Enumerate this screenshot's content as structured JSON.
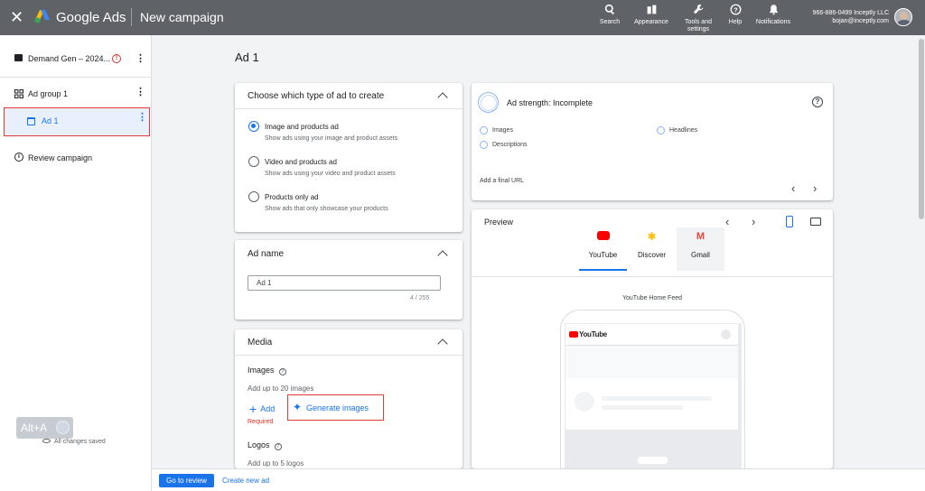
{
  "topbar": {
    "close_glyph": "✕",
    "brand": "Google Ads",
    "crumb": "New campaign",
    "actions": [
      {
        "label": "Search",
        "icon": "search-icon"
      },
      {
        "label": "Appearance",
        "icon": "appearance-icon"
      },
      {
        "label": "Tools and settings",
        "icon": "wrench-icon"
      },
      {
        "label": "Help",
        "icon": "help-icon"
      },
      {
        "label": "Notifications",
        "icon": "bell-icon"
      }
    ],
    "account_line1": "966-886-0499 Inceptly LLC",
    "account_line2": "bojan@inceptly.com"
  },
  "sidebar": {
    "campaign": "Demand Gen – 2024...",
    "ad_group": "Ad group 1",
    "ad": "Ad 1",
    "review": "Review campaign",
    "more_glyph": "⋮",
    "alert_glyph": "!",
    "info_glyph": "i"
  },
  "overlay": {
    "alt_a": "Alt+A",
    "saved": "All changes saved"
  },
  "main": {
    "page_title": "Ad 1",
    "ad_type": {
      "heading": "Choose which type of ad to create",
      "options": [
        {
          "title": "Image and products ad",
          "sub": "Show ads using your image and product assets",
          "selected": true
        },
        {
          "title": "Video and products ad",
          "sub": "Show ads using your video and product assets",
          "selected": false
        },
        {
          "title": "Products only ad",
          "sub": "Show ads that only showcase your products",
          "selected": false
        }
      ]
    },
    "ad_name": {
      "heading": "Ad name",
      "value": "Ad 1",
      "counter": "4 / 255"
    },
    "media": {
      "heading": "Media",
      "images_label": "Images",
      "images_hint": "Add up to 20 images",
      "add_label": "Add",
      "generate_label": "Generate images",
      "required": "Required",
      "logos_label": "Logos",
      "logos_hint": "Add up to 5 logos",
      "help_glyph": "?"
    },
    "strength": {
      "title": "Ad strength: Incomplete",
      "items": [
        "Images",
        "Headlines",
        "Descriptions"
      ],
      "final_url": "Add a final URL",
      "help_glyph": "?",
      "prev": "‹",
      "next": "›"
    },
    "preview": {
      "heading": "Preview",
      "prev": "‹",
      "next": "›",
      "tabs": [
        {
          "label": "YouTube",
          "active": true
        },
        {
          "label": "Discover",
          "active": false
        },
        {
          "label": "Gmail",
          "active": false
        }
      ],
      "feed_label": "YouTube Home Feed",
      "yt_wordmark": "YouTube"
    }
  },
  "bottom": {
    "primary": "Go to review",
    "secondary": "Create new ad"
  },
  "colors": {
    "accent": "#1a73e8",
    "topbar": "#5f6368",
    "highlight_border": "#e53935",
    "required": "#d93025"
  }
}
